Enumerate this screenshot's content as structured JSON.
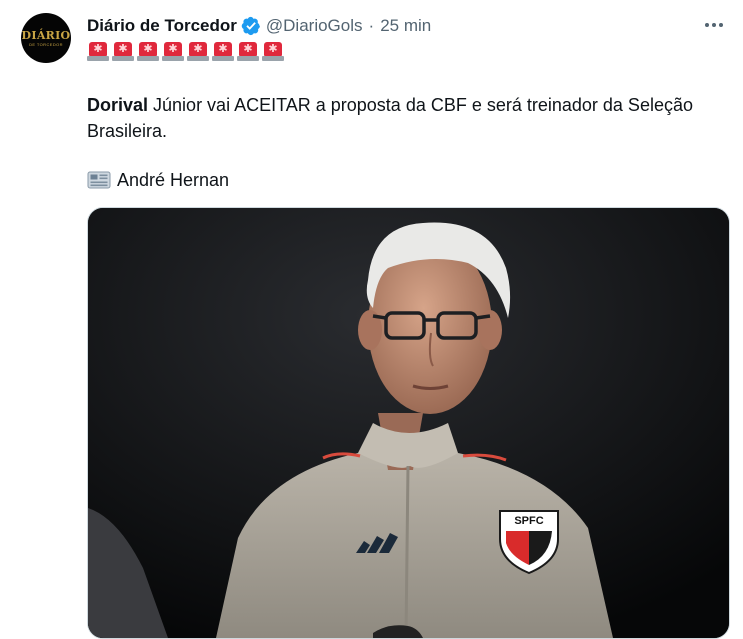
{
  "author": {
    "display_name": "Diário de Torcedor",
    "handle": "@DiarioGols",
    "separator": "·",
    "time": "25 min",
    "verified": true,
    "avatar_text": "DIÁRIO",
    "avatar_subtext": "DE TORCEDOR"
  },
  "icons": {
    "verified": "verified-badge-icon",
    "more": "more-options-icon",
    "siren": "police-car-light-emoji",
    "newspaper": "newspaper-emoji"
  },
  "tweet": {
    "siren_count": 8,
    "text_bold": "Dorival",
    "text_rest": " Júnior vai ACEITAR a proposta da CBF e será treinador da Seleção Brasileira.",
    "credit": "André Hernan"
  },
  "media": {
    "badge_text": "SPFC"
  },
  "colors": {
    "accent": "#1d9bf0",
    "text_primary": "#0f1419",
    "text_secondary": "#536471",
    "siren_red": "#e0283c"
  }
}
